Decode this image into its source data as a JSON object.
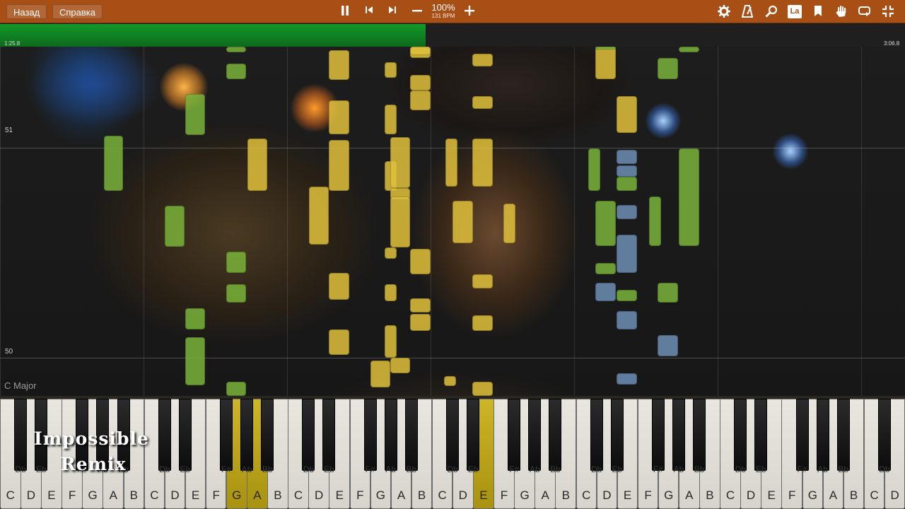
{
  "toolbar": {
    "back_label": "Назад",
    "help_label": "Справка",
    "zoom_value": "100%",
    "bpm_label": "131 BPM",
    "la_label": "La",
    "icons": [
      "pause-icon",
      "skip-back-icon",
      "skip-forward-icon",
      "zoom-out-icon",
      "zoom-in-icon",
      "settings-gear-icon",
      "metronome-icon",
      "search-icon",
      "la-icon",
      "bookmark-icon",
      "hand-icon",
      "loop-icon",
      "exit-fullscreen-icon"
    ]
  },
  "progress": {
    "current_time": "1:25.8",
    "total_time": "3:06.8",
    "fraction": 0.47,
    "color": "#129a2a"
  },
  "measures": [
    "51",
    "50"
  ],
  "key_signature": "C Major",
  "keyboard": {
    "white_keys": [
      "C",
      "D",
      "E",
      "F",
      "G",
      "A",
      "B",
      "C",
      "D",
      "E",
      "F",
      "G",
      "A",
      "B",
      "C",
      "D",
      "E",
      "F",
      "G",
      "A",
      "B",
      "C",
      "D",
      "E",
      "F",
      "G",
      "A",
      "B",
      "C",
      "D",
      "E",
      "F",
      "G",
      "A",
      "B",
      "C",
      "D",
      "E",
      "F",
      "G",
      "A",
      "B",
      "C",
      "D"
    ],
    "black_keys": [
      "Db",
      "Eb",
      "F#",
      "Ab",
      "Bb",
      "Db",
      "Eb",
      "F#",
      "Ab",
      "Bb",
      "Db",
      "Eb",
      "F#",
      "Ab",
      "Bb",
      "Db",
      "Eb",
      "F#",
      "Ab",
      "Bb",
      "Db",
      "Eb",
      "F#",
      "Ab",
      "Bb",
      "Db",
      "Eb",
      "F#",
      "Ab",
      "Bb",
      "Db"
    ],
    "highlighted_keys": [
      "G",
      "A",
      "E"
    ],
    "highlight_color": "#cdb528"
  },
  "overlay": {
    "line1": "Impossible",
    "line2": "Remix"
  },
  "colors": {
    "note_green": "#7ab33a",
    "note_yellow": "#e1c13c",
    "note_blue": "#6e8fb5",
    "toolbar": "#a84f16"
  }
}
